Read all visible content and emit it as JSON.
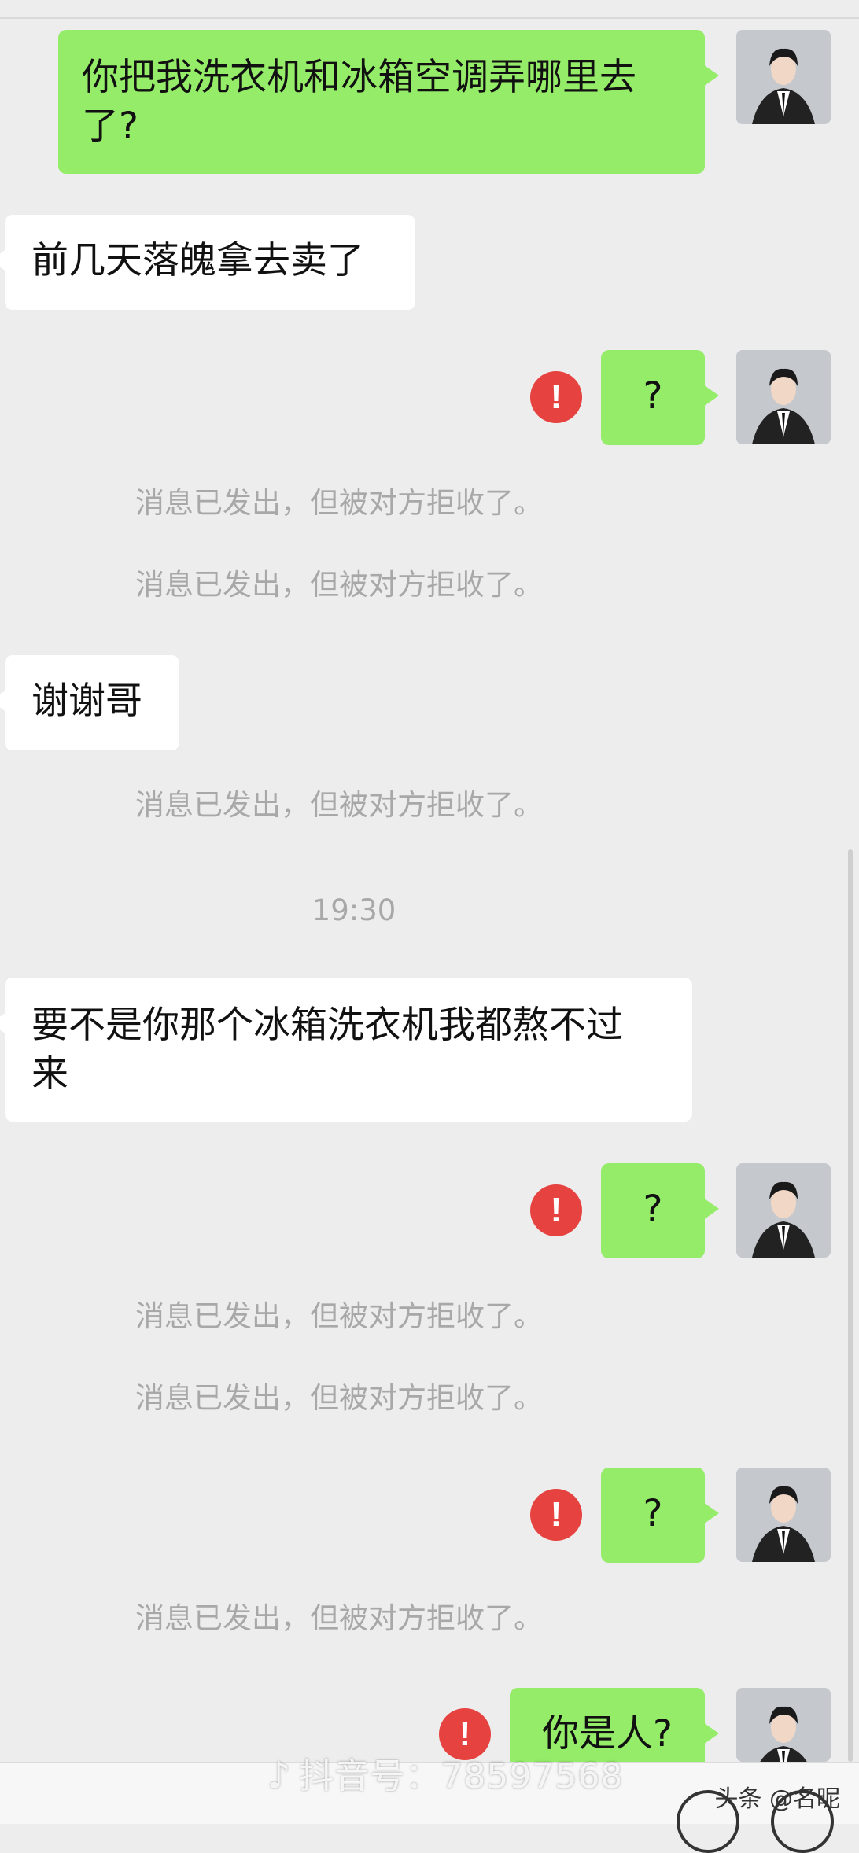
{
  "messages": [
    {
      "side": "out",
      "text": "你把我洗衣机和冰箱空调弄哪里去",
      "text2": "了?"
    },
    {
      "side": "in",
      "text": "前几天落魄拿去卖了"
    },
    {
      "side": "out",
      "text": "?",
      "error": "!"
    },
    {
      "side": "in",
      "text": "谢谢哥"
    },
    {
      "side": "in",
      "text": "要不是你那个冰箱洗衣机我都熬不过",
      "text2": "来"
    },
    {
      "side": "out",
      "text": "?",
      "error": "!"
    },
    {
      "side": "out",
      "text": "?",
      "error": "!"
    },
    {
      "side": "out",
      "text": "你是人?",
      "error": "!"
    }
  ],
  "system_notice": "消息已发出，但被对方拒收了。",
  "timestamp": "19:30",
  "watermark": {
    "icon": "tiktok-icon",
    "text": "抖音号：78597568"
  },
  "credit": "头条 @名昵",
  "colors": {
    "outgoing": "#95ec69",
    "incoming": "#ffffff",
    "error": "#e64340",
    "background": "#ededed"
  }
}
